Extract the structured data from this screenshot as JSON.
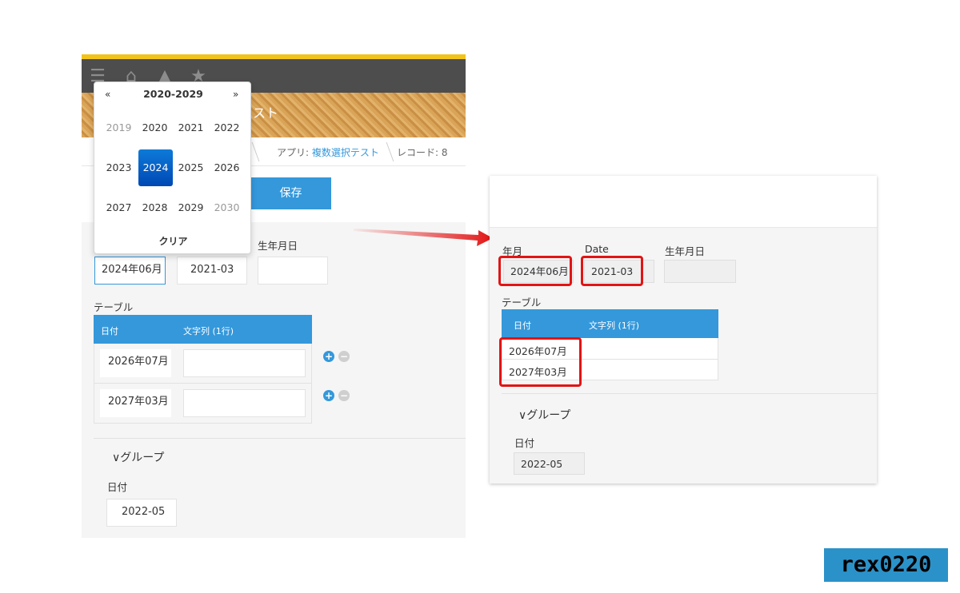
{
  "left": {
    "banner_text": "スト",
    "breadcrumb": {
      "app_label": "アプリ:",
      "app_name": "複数選択テスト",
      "record": "レコード: 8"
    },
    "save_label": "保存",
    "field_birth_label": "生年月日",
    "field_yearmonth_value": "2024年06月",
    "field_date_value": "2021-03",
    "field_birth_value": "",
    "table_label": "テーブル",
    "table_headers": [
      "日付",
      "文字列 (1行)"
    ],
    "table_rows": [
      {
        "date": "2026年07月",
        "text": ""
      },
      {
        "date": "2027年03月",
        "text": ""
      }
    ],
    "group_label": "∨グループ",
    "group_field_label": "日付",
    "group_field_value": "2022-05"
  },
  "datepicker": {
    "prev": "«",
    "next": "»",
    "range": "2020-2029",
    "years": [
      "2019",
      "2020",
      "2021",
      "2022",
      "2023",
      "2024",
      "2025",
      "2026",
      "2027",
      "2028",
      "2029",
      "2030"
    ],
    "selected": "2024",
    "clear": "クリア"
  },
  "right": {
    "field_yearmonth_label": "年月",
    "field_date_label": "Date",
    "field_birth_label": "生年月日",
    "field_yearmonth_value": "2024年06月",
    "field_date_value": "2021-03",
    "table_label": "テーブル",
    "table_headers": [
      "日付",
      "文字列 (1行)"
    ],
    "table_rows": [
      "2026年07月",
      "2027年03月"
    ],
    "group_label": "∨グループ",
    "group_field_label": "日付",
    "group_field_value": "2022-05"
  },
  "brand": "rex0220",
  "colors": {
    "accent": "#3498db",
    "highlight": "#e21414",
    "header_bar": "#f2c41a"
  },
  "icons": [
    "menu-icon",
    "home-icon",
    "bell-icon",
    "star-icon",
    "plus-icon",
    "minus-icon",
    "arrow-icon"
  ]
}
